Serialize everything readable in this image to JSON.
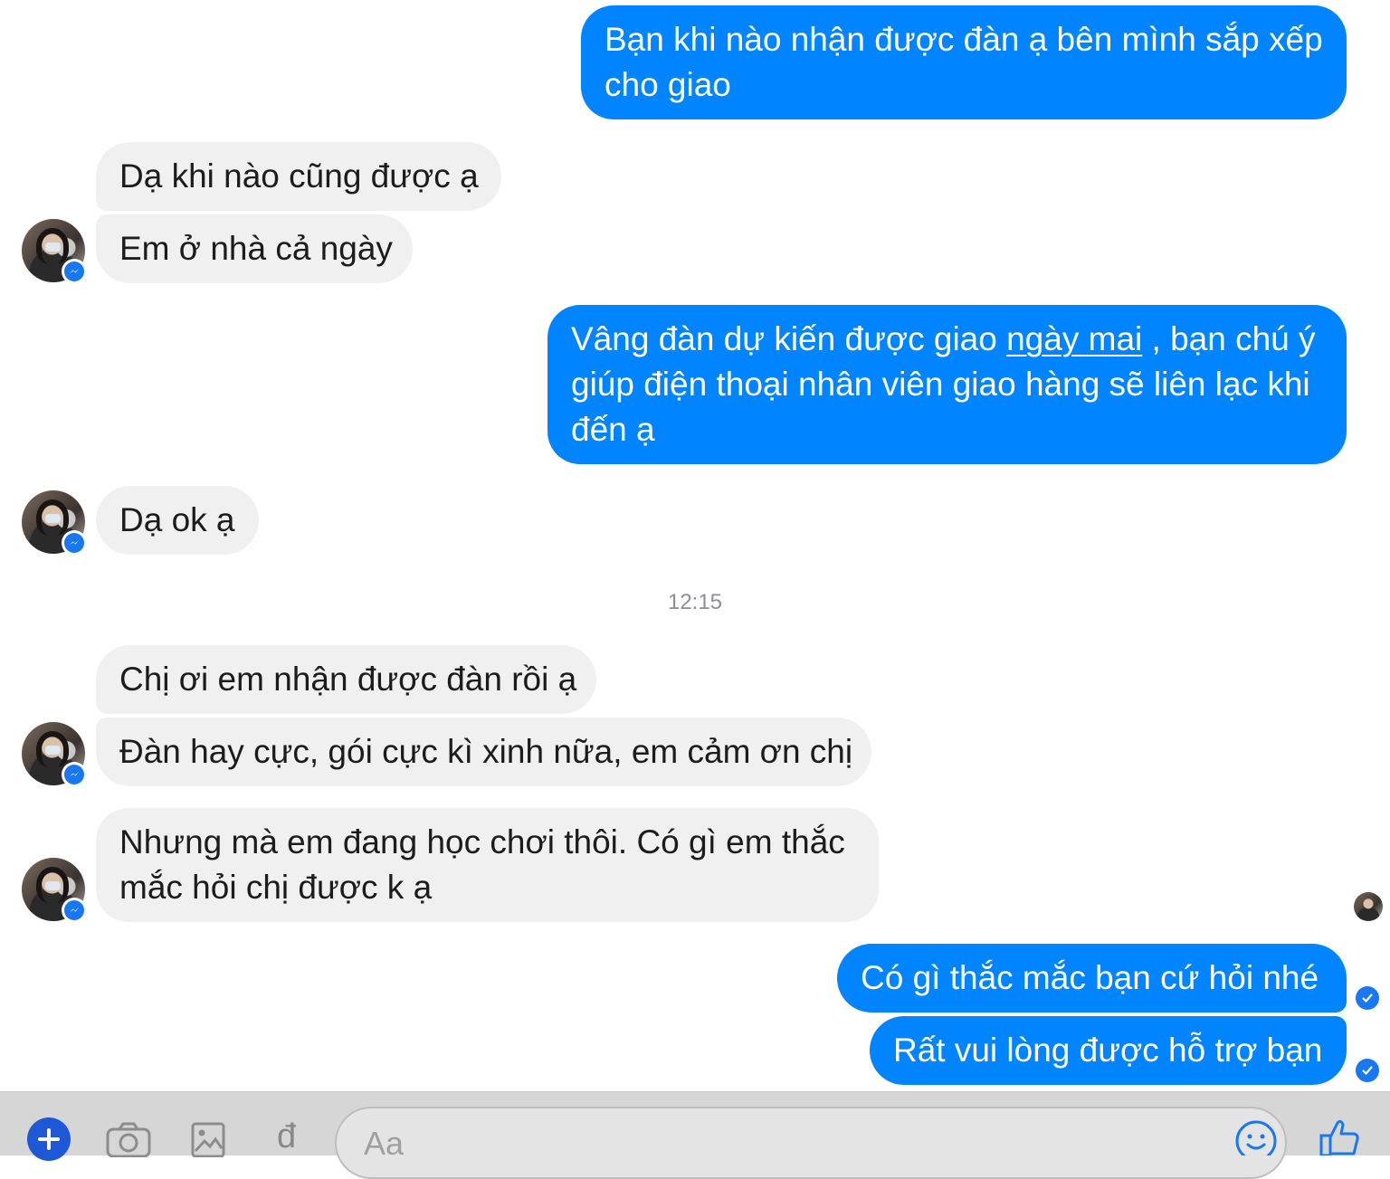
{
  "conversation": {
    "messages": [
      {
        "sender": "me",
        "lines": [
          "Bạn khi nào nhận được đàn ạ bên mình sắp xếp",
          "cho giao"
        ]
      },
      {
        "sender": "them",
        "text": "Dạ khi nào cũng được ạ"
      },
      {
        "sender": "them",
        "text": "Em ở nhà cả ngày"
      },
      {
        "sender": "me",
        "line1_pre": "Vâng đàn dự kiến được giao ",
        "line1_link": "ngày mai",
        "line1_post": " , bạn chú ý",
        "line2": "giúp điện thoại nhân viên giao hàng sẽ liên lạc khi",
        "line3": "đến ạ"
      },
      {
        "sender": "them",
        "text": "Dạ ok ạ"
      },
      {
        "sender": "them",
        "text": "Chị ơi em nhận được đàn rồi ạ"
      },
      {
        "sender": "them",
        "text": "Đàn hay cực, gói cực kì xinh nữa, em cảm ơn chị"
      },
      {
        "sender": "them",
        "lines": [
          "Nhưng mà em đang học chơi thôi. Có gì em thắc",
          "mắc hỏi chị được k ạ"
        ]
      },
      {
        "sender": "me",
        "text": "Có gì thắc mắc bạn cứ hỏi nhé"
      },
      {
        "sender": "me",
        "text": "Rất vui lòng được hỗ trợ bạn"
      }
    ],
    "timestamp": "12:15"
  },
  "composer": {
    "placeholder": "Aa",
    "currency_symbol": "đ",
    "icons": [
      "plus-icon",
      "camera-icon",
      "image-icon",
      "currency-icon",
      "emoji-icon",
      "thumbs-up-icon"
    ]
  },
  "colors": {
    "outgoing_bubble": "#0084ff",
    "incoming_bubble": "#f0f0f0",
    "messenger_badge": "#1877f2"
  }
}
